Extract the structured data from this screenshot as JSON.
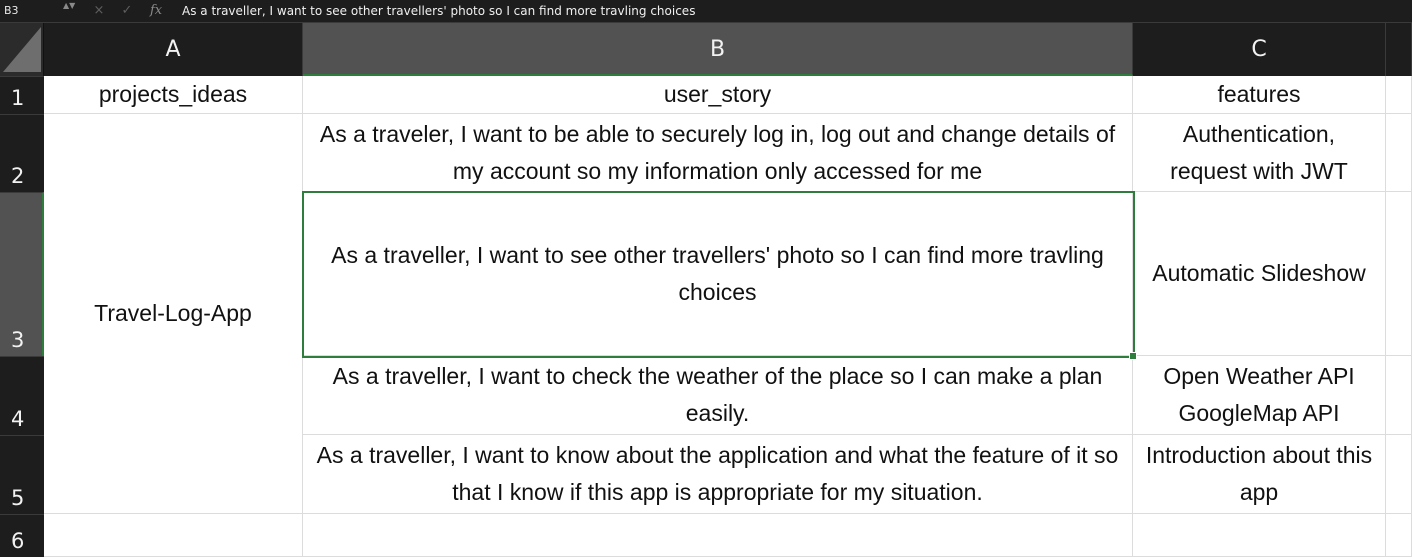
{
  "formula_bar": {
    "name_box": "B3",
    "spinner": "▲▼",
    "cancel_icon": "×",
    "confirm_icon": "✓",
    "fx_label": "fx",
    "content": "As a traveller, I want to see other travellers' photo so I can find more travling choices"
  },
  "columns": [
    "A",
    "B",
    "C"
  ],
  "rows": [
    "1",
    "2",
    "3",
    "4",
    "5",
    "6"
  ],
  "header_row": {
    "a": "projects_ideas",
    "b": "user_story",
    "c": "features"
  },
  "merged_a": "Travel-Log-App",
  "data_rows": [
    {
      "b": "As a traveler, I want to be able to securely log in, log out and change details of my account so my information only accessed for me",
      "c": "Authentication, request with JWT"
    },
    {
      "b": "As a traveller, I want to see other travellers' photo so I can find more travling choices",
      "c": "Automatic Slideshow"
    },
    {
      "b": "As a traveller, I want to check the weather of the place so I can make a plan easily.",
      "c": "Open Weather API GoogleMap API"
    },
    {
      "b": "As a traveller, I want to know about the application and what the feature of it so that I know if this app is appropriate for my situation.",
      "c": "Introduction about this app"
    },
    {
      "b": "",
      "c": ""
    }
  ],
  "colors": {
    "header_bg": "#1d1d1d",
    "selected_header_bg": "#525252",
    "selection_accent": "#2f7d3c"
  }
}
